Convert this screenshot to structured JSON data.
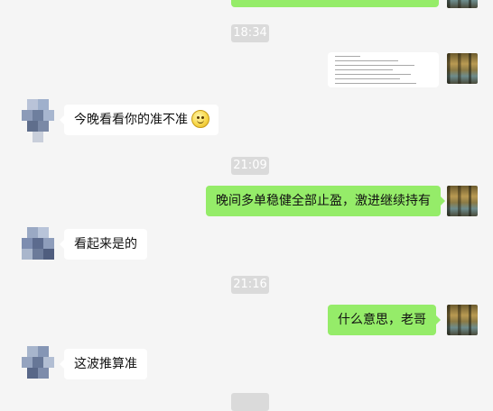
{
  "timestamps": [
    "18:34",
    "21:09",
    "21:16"
  ],
  "messages": [
    {
      "side": "them",
      "text": "今晚看看你的准不准",
      "emoji": "smile-emoji"
    },
    {
      "side": "me",
      "text": "晚间多单稳健全部止盈，激进继续持有"
    },
    {
      "side": "them",
      "text": "看起来是的"
    },
    {
      "side": "me",
      "text": "什么意思，老哥"
    },
    {
      "side": "them",
      "text": "这波推算准"
    }
  ],
  "image_message": {
    "kind": "document-screenshot"
  },
  "colors": {
    "background": "#f5f5f5",
    "my_bubble": "#95ec69",
    "their_bubble": "#ffffff",
    "timestamp_bg": "#dadada"
  }
}
